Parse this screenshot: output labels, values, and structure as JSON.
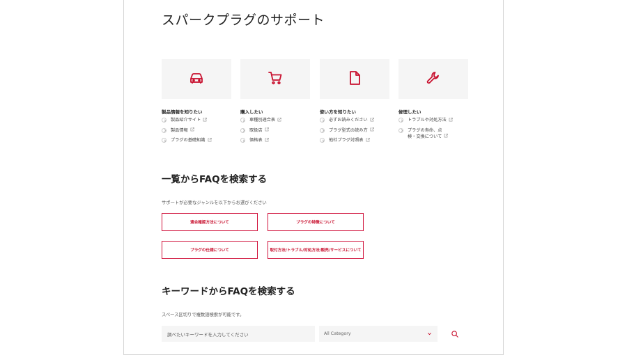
{
  "page": {
    "title": "スパークプラグのサポート"
  },
  "colors": {
    "accent": "#c8102e",
    "card_bg": "#f5f5f5"
  },
  "categories": [
    {
      "icon": "car-icon",
      "title": "製品情報を知りたい",
      "items": [
        "製品紹介サイト",
        "製品情報",
        "プラグの基礎知識"
      ]
    },
    {
      "icon": "cart-icon",
      "title": "購入したい",
      "items": [
        "車種別適合表",
        "取扱店",
        "価格表"
      ]
    },
    {
      "icon": "document-icon",
      "title": "使い方を知りたい",
      "items": [
        "必ずお読みください",
        "プラグ型式の読み方",
        "他社プラグ対照表"
      ]
    },
    {
      "icon": "wrench-icon",
      "title": "修理したい",
      "items": [
        "トラブルや対処方法",
        "プラグの寿命、点検・交換について"
      ]
    }
  ],
  "faq_list": {
    "title": "一覧からFAQを検索する",
    "description": "サポートが必要なジャンルを以下からお選びください",
    "buttons": [
      "適合確認方法について",
      "プラグの特徴について",
      "プラグの仕様について",
      "取付方法/トラブル/対処方法/販売/サービスについて"
    ]
  },
  "faq_keyword": {
    "title": "キーワードからFAQを検索する",
    "description": "スペース区切りで複数語検索が可能です。",
    "input_placeholder": "調べたいキーワードを入力してください",
    "category_selected": "All Category"
  }
}
